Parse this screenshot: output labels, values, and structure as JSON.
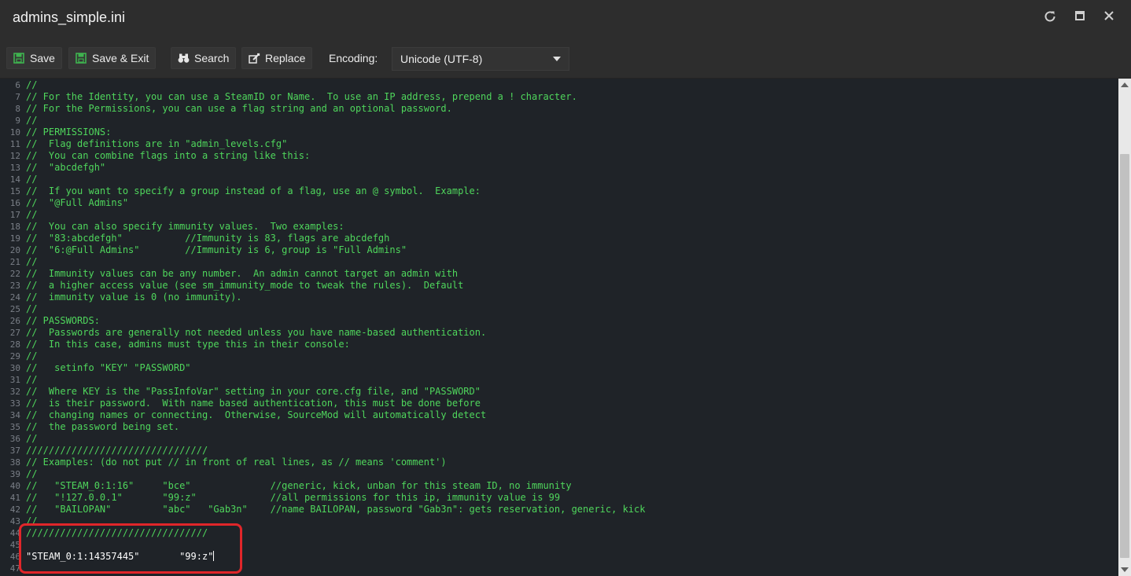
{
  "window": {
    "title": "admins_simple.ini",
    "refresh_icon": "refresh-icon",
    "maximize_icon": "maximize-icon",
    "close_icon": "close-icon"
  },
  "toolbar": {
    "save_label": "Save",
    "save_exit_label": "Save & Exit",
    "search_label": "Search",
    "replace_label": "Replace",
    "encoding_label": "Encoding:",
    "encoding_value": "Unicode (UTF-8)"
  },
  "colors": {
    "comment": "#4fd65c",
    "string": "#ffffff",
    "highlight": "#e0262a",
    "save_icon": "#3fb34f"
  },
  "editor": {
    "lines": [
      {
        "n": "6",
        "text": "//",
        "kind": "cm"
      },
      {
        "n": "7",
        "text": "// For the Identity, you can use a SteamID or Name.  To use an IP address, prepend a ! character.",
        "kind": "cm"
      },
      {
        "n": "8",
        "text": "// For the Permissions, you can use a flag string and an optional password.",
        "kind": "cm"
      },
      {
        "n": "9",
        "text": "//",
        "kind": "cm"
      },
      {
        "n": "10",
        "text": "// PERMISSIONS:",
        "kind": "cm"
      },
      {
        "n": "11",
        "text": "//  Flag definitions are in \"admin_levels.cfg\"",
        "kind": "cm"
      },
      {
        "n": "12",
        "text": "//  You can combine flags into a string like this:",
        "kind": "cm"
      },
      {
        "n": "13",
        "text": "//  \"abcdefgh\"",
        "kind": "cm"
      },
      {
        "n": "14",
        "text": "//",
        "kind": "cm"
      },
      {
        "n": "15",
        "text": "//  If you want to specify a group instead of a flag, use an @ symbol.  Example:",
        "kind": "cm"
      },
      {
        "n": "16",
        "text": "//  \"@Full Admins\"",
        "kind": "cm"
      },
      {
        "n": "17",
        "text": "//",
        "kind": "cm"
      },
      {
        "n": "18",
        "text": "//  You can also specify immunity values.  Two examples:",
        "kind": "cm"
      },
      {
        "n": "19",
        "text": "//  \"83:abcdefgh\"           //Immunity is 83, flags are abcdefgh",
        "kind": "cm"
      },
      {
        "n": "20",
        "text": "//  \"6:@Full Admins\"        //Immunity is 6, group is \"Full Admins\"",
        "kind": "cm"
      },
      {
        "n": "21",
        "text": "//",
        "kind": "cm"
      },
      {
        "n": "22",
        "text": "//  Immunity values can be any number.  An admin cannot target an admin with",
        "kind": "cm"
      },
      {
        "n": "23",
        "text": "//  a higher access value (see sm_immunity_mode to tweak the rules).  Default",
        "kind": "cm"
      },
      {
        "n": "24",
        "text": "//  immunity value is 0 (no immunity).",
        "kind": "cm"
      },
      {
        "n": "25",
        "text": "//",
        "kind": "cm"
      },
      {
        "n": "26",
        "text": "// PASSWORDS:",
        "kind": "cm"
      },
      {
        "n": "27",
        "text": "//  Passwords are generally not needed unless you have name-based authentication.",
        "kind": "cm"
      },
      {
        "n": "28",
        "text": "//  In this case, admins must type this in their console:",
        "kind": "cm"
      },
      {
        "n": "29",
        "text": "//",
        "kind": "cm"
      },
      {
        "n": "30",
        "text": "//   setinfo \"KEY\" \"PASSWORD\"",
        "kind": "cm"
      },
      {
        "n": "31",
        "text": "//",
        "kind": "cm"
      },
      {
        "n": "32",
        "text": "//  Where KEY is the \"PassInfoVar\" setting in your core.cfg file, and \"PASSWORD\"",
        "kind": "cm"
      },
      {
        "n": "33",
        "text": "//  is their password.  With name based authentication, this must be done before",
        "kind": "cm"
      },
      {
        "n": "34",
        "text": "//  changing names or connecting.  Otherwise, SourceMod will automatically detect",
        "kind": "cm"
      },
      {
        "n": "35",
        "text": "//  the password being set.",
        "kind": "cm"
      },
      {
        "n": "36",
        "text": "//",
        "kind": "cm"
      },
      {
        "n": "37",
        "text": "////////////////////////////////",
        "kind": "cm"
      },
      {
        "n": "38",
        "text": "// Examples: (do not put // in front of real lines, as // means 'comment')",
        "kind": "cm"
      },
      {
        "n": "39",
        "text": "//",
        "kind": "cm"
      },
      {
        "n": "40",
        "text": "//   \"STEAM_0:1:16\"     \"bce\"              //generic, kick, unban for this steam ID, no immunity",
        "kind": "cm"
      },
      {
        "n": "41",
        "text": "//   \"!127.0.0.1\"       \"99:z\"             //all permissions for this ip, immunity value is 99",
        "kind": "cm"
      },
      {
        "n": "42",
        "text": "//   \"BAILOPAN\"         \"abc\"   \"Gab3n\"    //name BAILOPAN, password \"Gab3n\": gets reservation, generic, kick",
        "kind": "cm"
      },
      {
        "n": "43",
        "text": "//",
        "kind": "cm"
      },
      {
        "n": "44",
        "text": "////////////////////////////////",
        "kind": "cm"
      },
      {
        "n": "45",
        "text": "",
        "kind": "st"
      },
      {
        "n": "46",
        "text": "\"STEAM_0:1:14357445\"       \"99:z\"",
        "kind": "st",
        "cursor": true
      },
      {
        "n": "47",
        "text": "",
        "kind": "st"
      }
    ]
  }
}
